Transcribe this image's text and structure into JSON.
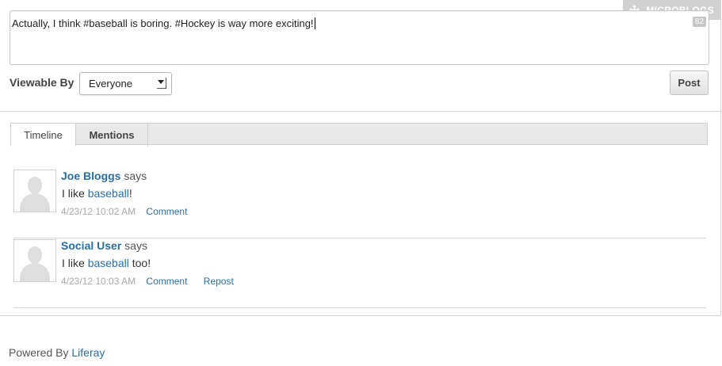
{
  "portlet": {
    "title": "MICROBLOGS",
    "move_icon": "move-arrows-icon"
  },
  "composer": {
    "text": "Actually, I think #baseball is boring. #Hockey is way more exciting!",
    "char_count": "82"
  },
  "viewable": {
    "label": "Viewable By",
    "selected": "Everyone"
  },
  "post_label": "Post",
  "tabs": [
    {
      "label": "Timeline",
      "active": true
    },
    {
      "label": "Mentions",
      "active": false
    }
  ],
  "entries": [
    {
      "author": "Joe Bloggs",
      "says": "says",
      "text_before": "I like ",
      "hashtag": "baseball",
      "text_after": "!",
      "timestamp": "4/23/12 10:02 AM",
      "actions": [
        "Comment"
      ]
    },
    {
      "author": "Social User",
      "says": "says",
      "text_before": "I like ",
      "hashtag": "baseball",
      "text_after": " too!",
      "timestamp": "4/23/12 10:03 AM",
      "actions": [
        "Comment",
        "Repost"
      ]
    }
  ],
  "footer": {
    "powered_by": "Powered By",
    "brand": "Liferay"
  },
  "colors": {
    "link": "#2a6ea6",
    "timestamp": "#a8a8a8",
    "title_bar": "#c9c9c9"
  }
}
